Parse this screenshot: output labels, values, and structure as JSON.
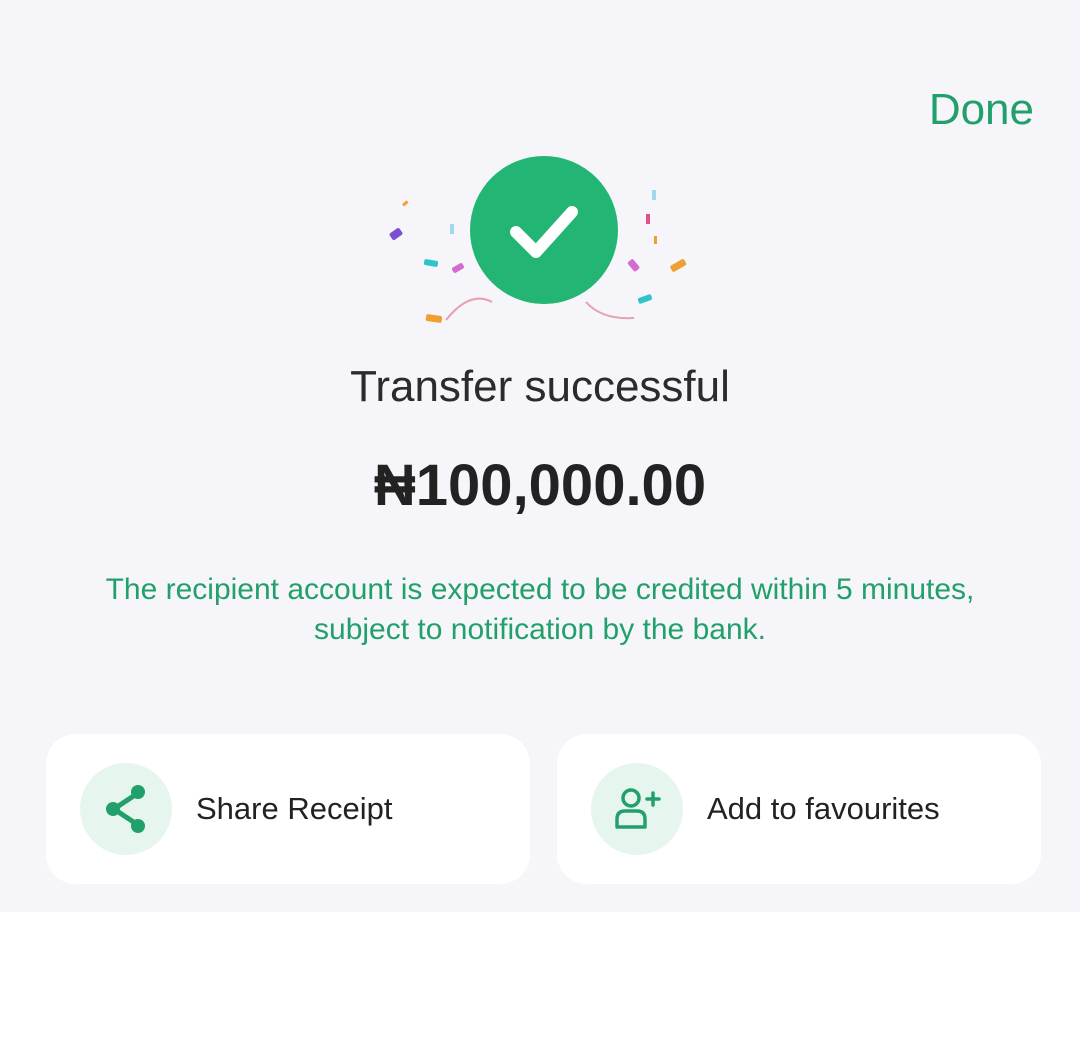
{
  "header": {
    "done_label": "Done"
  },
  "status": {
    "title": "Transfer successful",
    "amount": "₦100,000.00",
    "notice": "The recipient account is expected to be credited within 5 minutes, subject to notification by the bank."
  },
  "actions": [
    {
      "label": "Share Receipt",
      "icon": "share-icon"
    },
    {
      "label": "Add to favourites",
      "icon": "add-user-icon"
    }
  ],
  "colors": {
    "accent": "#22a06b",
    "success": "#22b573",
    "background": "#f6f5fa",
    "card": "#ffffff"
  }
}
